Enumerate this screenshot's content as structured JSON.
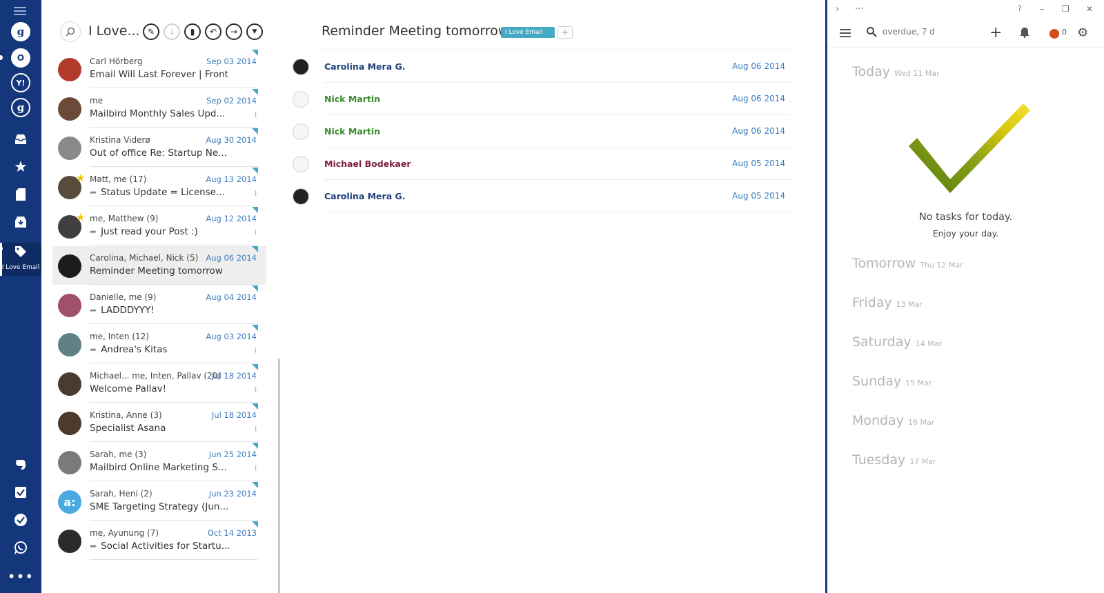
{
  "sidebar": {
    "items": [
      {
        "name": "menu"
      },
      {
        "name": "google-account-1",
        "glyph": "g"
      },
      {
        "name": "outlook-account",
        "glyph": "O"
      },
      {
        "name": "yahoo-account",
        "glyph": "Y!"
      },
      {
        "name": "google-account-2",
        "glyph": "g"
      },
      {
        "name": "inbox"
      },
      {
        "name": "starred"
      },
      {
        "name": "drafts"
      },
      {
        "name": "archive"
      }
    ],
    "active_label": "I Love Email",
    "apps": [
      "evernote",
      "todo",
      "tasks",
      "whatsapp",
      "more"
    ]
  },
  "list": {
    "folder_title": "I Love...",
    "threads": [
      {
        "who": "Carl Hörberg",
        "date": "Sep 03 2014",
        "subject": "Email Will Last Forever | Front",
        "reply": false,
        "star": false,
        "attach": false,
        "avatar": "#b23a2a"
      },
      {
        "who": "me",
        "date": "Sep 02 2014",
        "subject": "Mailbird Monthly Sales Upd...",
        "reply": false,
        "star": false,
        "attach": true,
        "avatar": "#6b4a3a"
      },
      {
        "who": "Kristina Viderø",
        "date": "Aug 30 2014",
        "subject": "Out of office Re: Startup Ne...",
        "reply": false,
        "star": false,
        "attach": false,
        "avatar": "#8a8a8a"
      },
      {
        "who": "Matt, me   (17)",
        "date": "Aug 13 2014",
        "subject": "Status Update = License...",
        "reply": true,
        "star": true,
        "attach": true,
        "avatar": "#5a4c3c"
      },
      {
        "who": "me, Matthew   (9)",
        "date": "Aug 12 2014",
        "subject": "Just read your Post :)",
        "reply": true,
        "star": true,
        "attach": true,
        "avatar": "#3f3f3f"
      },
      {
        "who": "Carolina, Michael, Nick   (5)",
        "date": "Aug 06 2014",
        "subject": "Reminder Meeting tomorrow",
        "reply": false,
        "star": false,
        "attach": false,
        "avatar": "#1c1c1c",
        "selected": true
      },
      {
        "who": "Danielle, me   (9)",
        "date": "Aug 04 2014",
        "subject": "LADDDYYY!",
        "reply": true,
        "star": false,
        "attach": false,
        "avatar": "#a0506a"
      },
      {
        "who": "me, Inten   (12)",
        "date": "Aug 03 2014",
        "subject": "Andrea's Kitas",
        "reply": true,
        "star": false,
        "attach": true,
        "avatar": "#5f8085"
      },
      {
        "who": "Michael... me, Inten, Pallav   (20)",
        "date": "Jul 18 2014",
        "subject": "Welcome Pallav!",
        "reply": false,
        "star": false,
        "attach": true,
        "avatar": "#4a3a30"
      },
      {
        "who": "Kristina, Anne   (3)",
        "date": "Jul 18 2014",
        "subject": "Specialist Asana",
        "reply": false,
        "star": false,
        "attach": true,
        "avatar": "#4d3a2c"
      },
      {
        "who": "Sarah, me   (3)",
        "date": "Jun 25 2014",
        "subject": "Mailbird Online Marketing S...",
        "reply": false,
        "star": false,
        "attach": true,
        "avatar": "#7a7a7a"
      },
      {
        "who": "Sarah, Heni   (2)",
        "date": "Jun 23 2014",
        "subject": "SME Targeting Strategy (Jun...",
        "reply": false,
        "star": false,
        "attach": false,
        "avatar": "#4aa9e0",
        "avatar_text": "a:"
      },
      {
        "who": "me, Ayunung   (7)",
        "date": "Oct 14 2013",
        "subject": "Social Activities for Startu...",
        "reply": true,
        "star": false,
        "attach": false,
        "avatar": "#2b2b2b"
      }
    ]
  },
  "conversation": {
    "title": "Reminder Meeting tomorrow",
    "label": "I Love Email",
    "messages": [
      {
        "name": "Carolina Mera G.",
        "date": "Aug 06 2014",
        "color": "#1f3f7a",
        "photo": true
      },
      {
        "name": "Nick Martin",
        "date": "Aug 06 2014",
        "color": "#3c8a2a",
        "photo": false
      },
      {
        "name": "Nick Martin",
        "date": "Aug 06 2014",
        "color": "#3c8a2a",
        "photo": false
      },
      {
        "name": "Michael Bodekaer",
        "date": "Aug 05 2014",
        "color": "#7a1f3a",
        "photo": false
      },
      {
        "name": "Carolina Mera G.",
        "date": "Aug 05 2014",
        "color": "#1f3f7a",
        "photo": true
      }
    ]
  },
  "tasks": {
    "search_placeholder": "overdue, 7 d",
    "badge_count": "0",
    "no_tasks": "No tasks for today.",
    "enjoy": "Enjoy your day.",
    "days": [
      {
        "name": "Today",
        "date": "Wed 11 Mar"
      },
      {
        "name": "Tomorrow",
        "date": "Thu 12 Mar"
      },
      {
        "name": "Friday",
        "date": "13 Mar"
      },
      {
        "name": "Saturday",
        "date": "14 Mar"
      },
      {
        "name": "Sunday",
        "date": "15 Mar"
      },
      {
        "name": "Monday",
        "date": "16 Mar"
      },
      {
        "name": "Tuesday",
        "date": "17 Mar"
      }
    ],
    "window": {
      "help": "?",
      "minimize": "–",
      "restore": "❐",
      "close": "✕",
      "expand": "›",
      "more": "···"
    }
  },
  "colors": {
    "rail": "#14367a",
    "accent": "#45a9c6",
    "date_blue": "#3b7bbf"
  }
}
